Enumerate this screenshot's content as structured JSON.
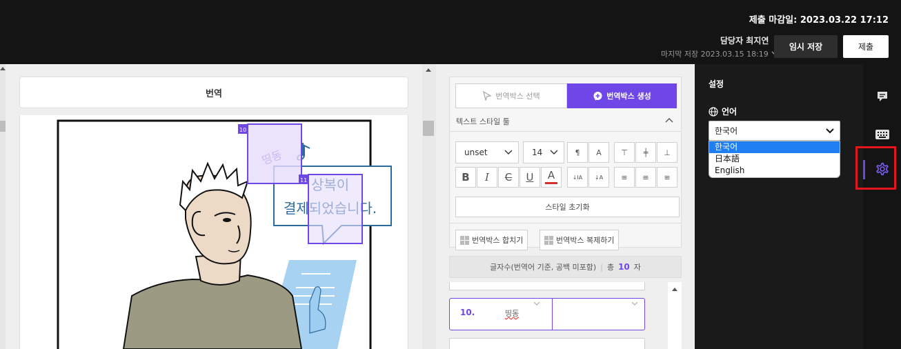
{
  "header": {
    "deadline": "제출 마감일: 2023.03.22 17:12",
    "manager": "담당자 최지연",
    "last_save": "마지막 저장 2023.03.15 18:19",
    "temp_save_label": "임시 저장",
    "submit_label": "제출"
  },
  "left": {
    "title": "번역",
    "box_labels": [
      "10",
      "11"
    ],
    "box_texts": [
      "띵동",
      "상복이 결제되었습니다."
    ]
  },
  "tool": {
    "select_box_label": "번역박스 선택",
    "create_box_label": "번역박스 생성",
    "text_style_tools": "텍스트 스타일 툴",
    "font_value": "unset",
    "size_value": "14",
    "reset_label": "스타일 초기화",
    "merge_label": "번역박스 합치기",
    "duplicate_label": "번역박스 복제하기",
    "char_count_label": "글자수(번역어 기준, 공백 미포함)",
    "char_total_prefix": "총",
    "char_total": "10",
    "char_unit": "자"
  },
  "list": {
    "active_item_number": "10.",
    "active_item_text": "띵동"
  },
  "settings": {
    "title": "설정",
    "language_label": "언어",
    "language_value": "한국어",
    "language_options": [
      "한국어",
      "日本語",
      "English"
    ]
  },
  "colors": {
    "accent": "#6e47e6",
    "highlight": "#e5161b",
    "selected_option": "#1e7ef2"
  },
  "icons": [
    "chevron-down-icon",
    "cursor-icon",
    "plus-chat-icon",
    "globe-icon",
    "comment-icon",
    "keyboard-icon",
    "gear-icon"
  ]
}
